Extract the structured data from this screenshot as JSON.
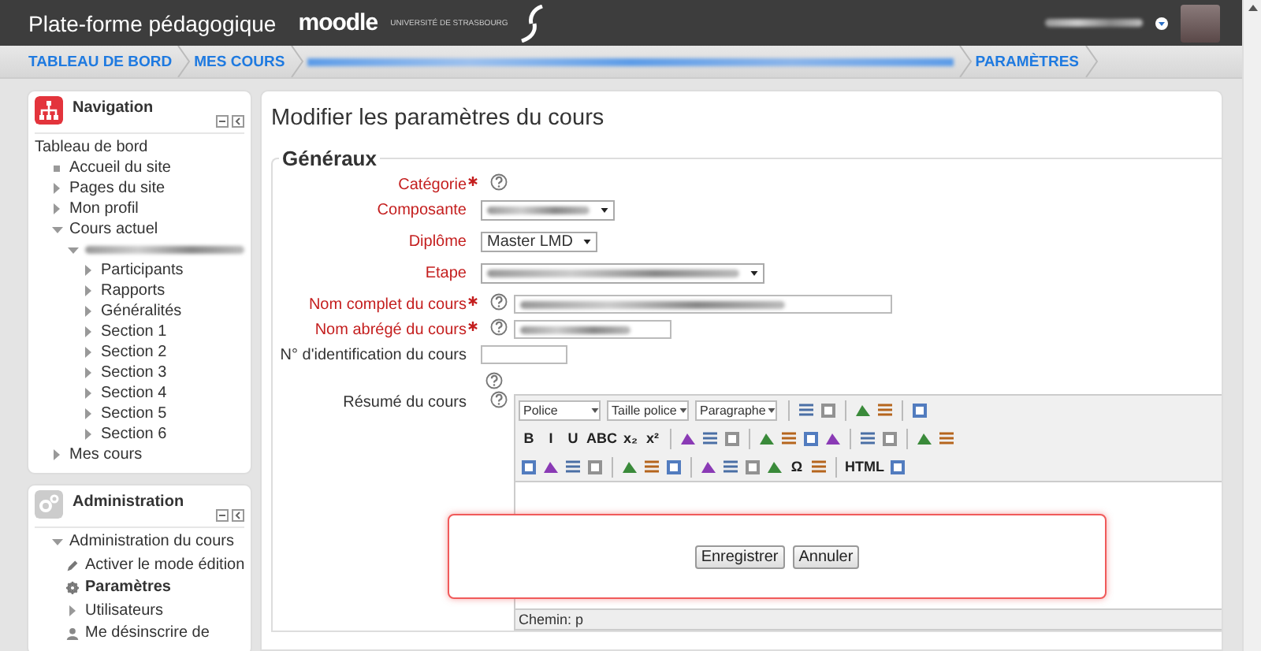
{
  "header": {
    "title": "Plate-forme pédagogique",
    "logo_text": "moodle",
    "logo_subtitle": "UNIVERSITÉ DE STRASBOURG"
  },
  "breadcrumb": [
    {
      "label": "TABLEAU DE BORD",
      "redacted": false
    },
    {
      "label": "MES COURS",
      "redacted": false
    },
    {
      "redacted": true
    },
    {
      "label": "PARAMÈTRES",
      "redacted": false
    }
  ],
  "navigation": {
    "title": "Navigation",
    "items": [
      {
        "label": "Tableau de bord",
        "kind": "plain",
        "children": [
          {
            "label": "Accueil du site",
            "kind": "leaf"
          },
          {
            "label": "Pages du site",
            "kind": "collapsed"
          },
          {
            "label": "Mon profil",
            "kind": "collapsed"
          },
          {
            "label": "Cours actuel",
            "kind": "expanded",
            "children": [
              {
                "kind": "expanded",
                "redacted": true,
                "children": [
                  {
                    "label": "Participants",
                    "kind": "collapsed"
                  },
                  {
                    "label": "Rapports",
                    "kind": "collapsed"
                  },
                  {
                    "label": "Généralités",
                    "kind": "collapsed"
                  },
                  {
                    "label": "Section 1",
                    "kind": "collapsed"
                  },
                  {
                    "label": "Section 2",
                    "kind": "collapsed"
                  },
                  {
                    "label": "Section 3",
                    "kind": "collapsed"
                  },
                  {
                    "label": "Section 4",
                    "kind": "collapsed"
                  },
                  {
                    "label": "Section 5",
                    "kind": "collapsed"
                  },
                  {
                    "label": "Section 6",
                    "kind": "collapsed"
                  }
                ]
              }
            ]
          },
          {
            "label": "Mes cours",
            "kind": "collapsed"
          }
        ]
      }
    ]
  },
  "administration": {
    "title": "Administration",
    "items": [
      {
        "label": "Administration du cours",
        "kind": "expanded",
        "selected": false,
        "children": [
          {
            "label": "Activer le mode édition",
            "kind": "pencil",
            "selected": false
          },
          {
            "label": "Paramètres",
            "kind": "gear",
            "selected": true
          },
          {
            "label": "Utilisateurs",
            "kind": "collapsed",
            "selected": false
          },
          {
            "label": "Me désinscrire de",
            "kind": "person",
            "selected": false
          }
        ]
      }
    ]
  },
  "main": {
    "title": "Modifier les paramètres du cours",
    "section": "Généraux",
    "fields": [
      {
        "label": "Catégorie",
        "highlighted": true,
        "required": true,
        "help": {
          "kind": "inline"
        },
        "control": {
          "kind": "none"
        }
      },
      {
        "label": "Composante",
        "highlighted": true,
        "required": false,
        "control": {
          "kind": "select",
          "redacted": true
        }
      },
      {
        "label": "Diplôme",
        "highlighted": true,
        "required": false,
        "control": {
          "kind": "select",
          "redacted": false,
          "value": "Master LMD"
        }
      },
      {
        "label": "Etape",
        "highlighted": true,
        "required": false,
        "control": {
          "kind": "select",
          "redacted": true
        }
      },
      {
        "label": "Nom complet du cours",
        "highlighted": true,
        "required": true,
        "help": {
          "kind": "inline"
        },
        "control": {
          "kind": "input",
          "redacted": true
        }
      },
      {
        "label": "Nom abrégé du cours",
        "highlighted": true,
        "required": true,
        "help": {
          "kind": "inline"
        },
        "control": {
          "kind": "input",
          "redacted": true
        }
      },
      {
        "label": "N° d'identification du cours",
        "highlighted": false,
        "required": false,
        "help": {
          "kind": "below"
        },
        "control": {
          "kind": "input",
          "redacted": false
        }
      },
      {
        "label": "Résumé du cours",
        "highlighted": false,
        "required": false,
        "help": {
          "kind": "inline"
        },
        "control": {
          "kind": "editor"
        }
      }
    ],
    "editor": {
      "toolbars": [
        [
          {
            "kind": "select",
            "label": "Police"
          },
          {
            "kind": "select",
            "label": "Taille police"
          },
          {
            "kind": "select",
            "label": "Paragraphe"
          },
          {
            "kind": "sep"
          },
          {
            "kind": "icon"
          },
          {
            "kind": "icon"
          },
          {
            "kind": "sep"
          },
          {
            "kind": "icon"
          },
          {
            "kind": "icon"
          },
          {
            "kind": "sep"
          },
          {
            "kind": "icon"
          }
        ],
        [
          {
            "kind": "glyph",
            "label": "B"
          },
          {
            "kind": "glyph",
            "label": "I"
          },
          {
            "kind": "glyph",
            "label": "U"
          },
          {
            "kind": "glyph",
            "label": "ABC"
          },
          {
            "kind": "glyph",
            "label": "x₂"
          },
          {
            "kind": "glyph",
            "label": "x²"
          },
          {
            "kind": "sep"
          },
          {
            "kind": "icon"
          },
          {
            "kind": "icon"
          },
          {
            "kind": "icon"
          },
          {
            "kind": "sep"
          },
          {
            "kind": "icon"
          },
          {
            "kind": "icon"
          },
          {
            "kind": "icon"
          },
          {
            "kind": "icon"
          },
          {
            "kind": "sep"
          },
          {
            "kind": "icon"
          },
          {
            "kind": "icon"
          },
          {
            "kind": "sep"
          },
          {
            "kind": "icon"
          },
          {
            "kind": "icon"
          }
        ],
        [
          {
            "kind": "icon"
          },
          {
            "kind": "icon"
          },
          {
            "kind": "icon"
          },
          {
            "kind": "icon"
          },
          {
            "kind": "sep"
          },
          {
            "kind": "icon"
          },
          {
            "kind": "icon"
          },
          {
            "kind": "icon"
          },
          {
            "kind": "sep"
          },
          {
            "kind": "icon"
          },
          {
            "kind": "icon"
          },
          {
            "kind": "icon"
          },
          {
            "kind": "icon"
          },
          {
            "kind": "glyph",
            "label": "Ω"
          },
          {
            "kind": "icon"
          },
          {
            "kind": "sep"
          },
          {
            "kind": "glyph",
            "label": "HTML"
          },
          {
            "kind": "icon"
          }
        ]
      ],
      "path": "Chemin: p"
    },
    "buttons": [
      "Enregistrer",
      "Annuler"
    ]
  }
}
